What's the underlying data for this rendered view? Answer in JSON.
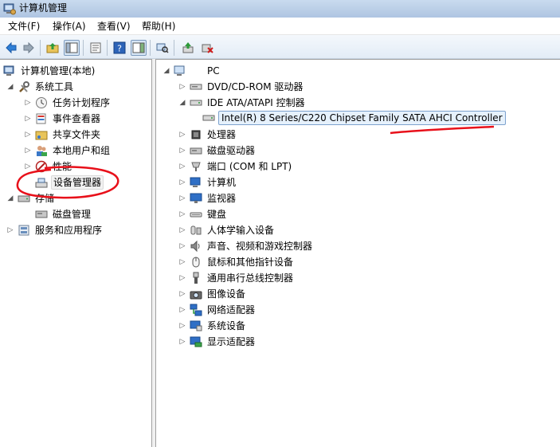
{
  "window": {
    "title": "计算机管理"
  },
  "menu": [
    {
      "label": "文件(F)"
    },
    {
      "label": "操作(A)"
    },
    {
      "label": "查看(V)"
    },
    {
      "label": "帮助(H)"
    }
  ],
  "left_tree": {
    "root": "计算机管理(本地)",
    "system_tools": "系统工具",
    "task_scheduler": "任务计划程序",
    "event_viewer": "事件查看器",
    "shared_folders": "共享文件夹",
    "local_users": "本地用户和组",
    "performance": "性能",
    "device_manager": "设备管理器",
    "storage": "存储",
    "disk_management": "磁盘管理",
    "services_apps": "服务和应用程序"
  },
  "device_tree": {
    "root": "PC",
    "categories": [
      {
        "label": "DVD/CD-ROM 驱动器"
      },
      {
        "label": "IDE ATA/ATAPI 控制器",
        "expanded": true,
        "children": [
          {
            "label": "Intel(R) 8 Series/C220 Chipset Family SATA AHCI Controller"
          }
        ]
      },
      {
        "label": "处理器"
      },
      {
        "label": "磁盘驱动器"
      },
      {
        "label": "端口 (COM 和 LPT)"
      },
      {
        "label": "计算机"
      },
      {
        "label": "监视器"
      },
      {
        "label": "键盘"
      },
      {
        "label": "人体学输入设备"
      },
      {
        "label": "声音、视频和游戏控制器"
      },
      {
        "label": "鼠标和其他指针设备"
      },
      {
        "label": "通用串行总线控制器"
      },
      {
        "label": "图像设备"
      },
      {
        "label": "网络适配器"
      },
      {
        "label": "系统设备"
      },
      {
        "label": "显示适配器"
      }
    ]
  },
  "colors": {
    "annotation": "#e8101a",
    "selection": "#7da2ce"
  }
}
